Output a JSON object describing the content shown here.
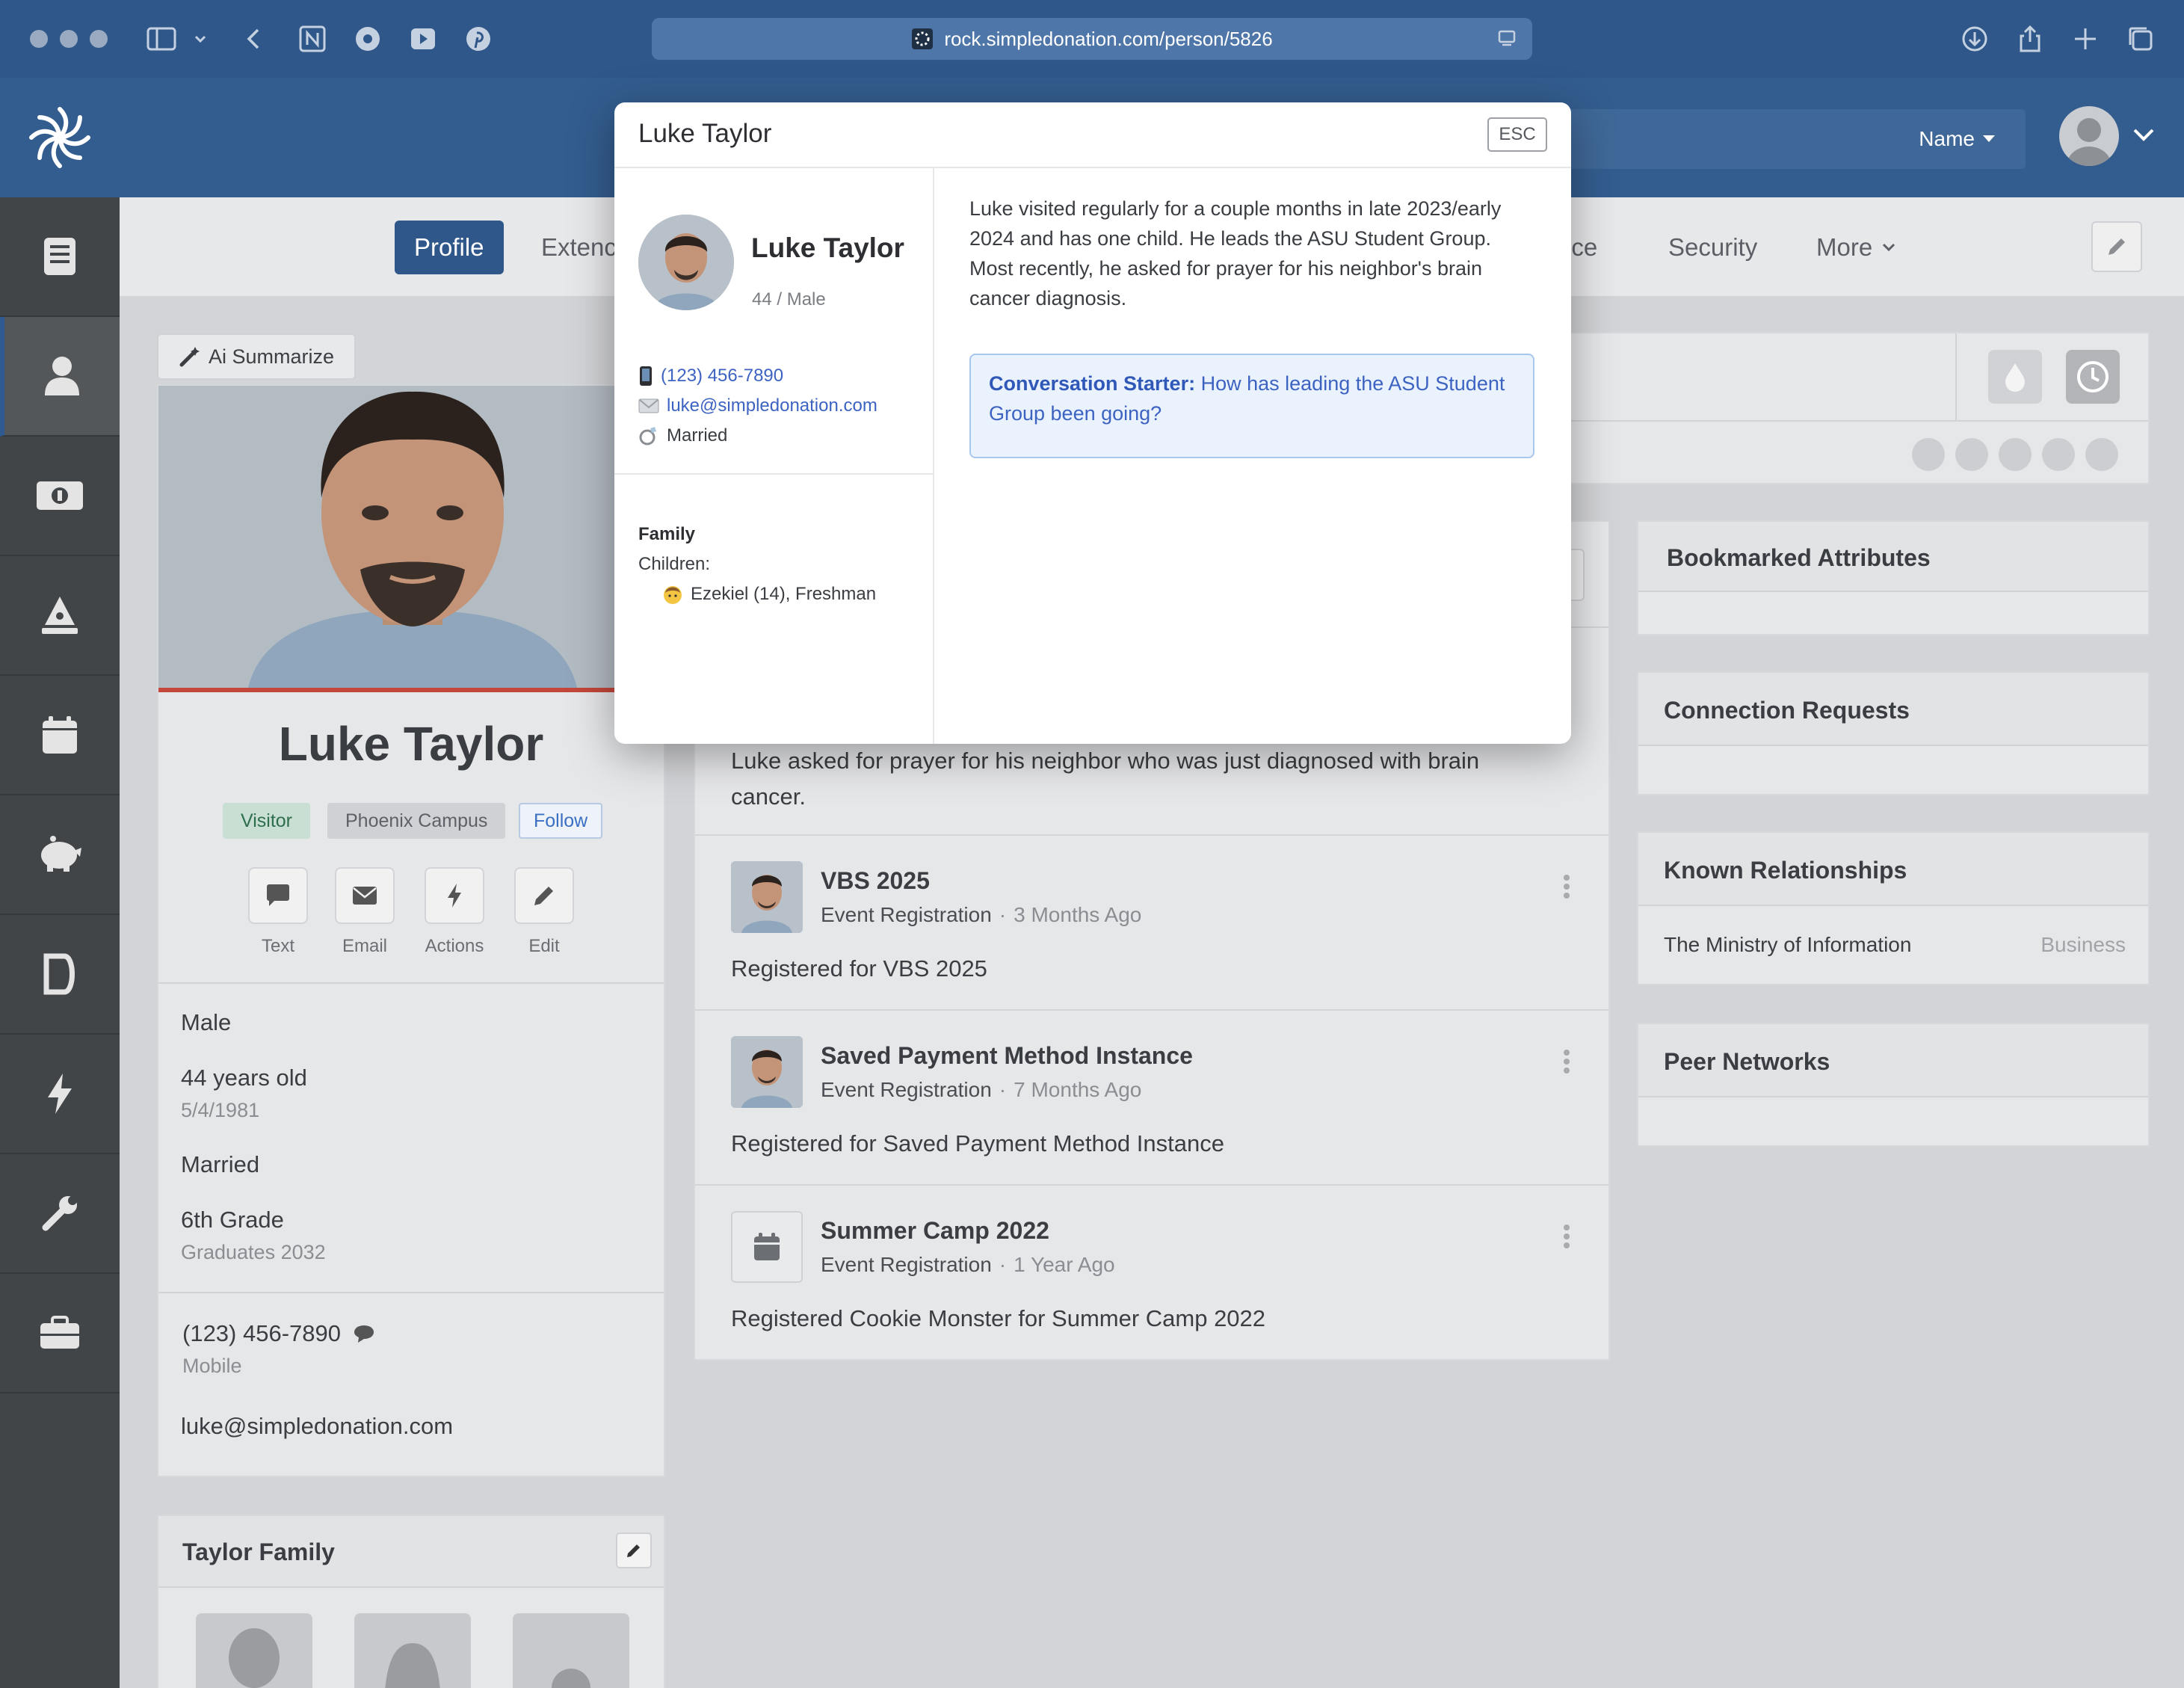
{
  "browser": {
    "url": "rock.simpledonation.com/person/5826"
  },
  "appbar": {
    "search_filter_label": "Name"
  },
  "tabs": {
    "profile": "Profile",
    "extended": "Extenc",
    "attendance_partial": "nce",
    "security": "Security",
    "more": "More"
  },
  "ai_summarize": {
    "label": "Ai Summarize"
  },
  "person": {
    "name": "Luke Taylor",
    "badges": [
      "Visitor",
      "Phoenix Campus",
      "Follow"
    ],
    "actions": [
      "Text",
      "Email",
      "Actions",
      "Edit"
    ],
    "gender": "Male",
    "age": "44 years old",
    "birthdate": "5/4/1981",
    "marital_status": "Married",
    "grade": "6th Grade",
    "graduation": "Graduates 2032",
    "phone": "(123) 456-7890",
    "phone_type": "Mobile",
    "email": "luke@simpledonation.com"
  },
  "family_card": {
    "title": "Taylor Family"
  },
  "feed": {
    "first_item_text": "Luke asked for prayer for his neighbor who was just diagnosed with brain cancer.",
    "items": [
      {
        "title": "VBS 2025",
        "type": "Event Registration",
        "sep": "·",
        "when": "3 Months Ago",
        "body": "Registered for VBS 2025"
      },
      {
        "title": "Saved Payment Method Instance",
        "type": "Event Registration",
        "sep": "·",
        "when": "7 Months Ago",
        "body": "Registered for Saved Payment Method Instance"
      },
      {
        "title": "Summer Camp 2022",
        "type": "Event Registration",
        "sep": "·",
        "when": "1 Year Ago",
        "body": "Registered Cookie Monster  for Summer Camp 2022"
      }
    ]
  },
  "right_cards": {
    "bookmarked": "Bookmarked Attributes",
    "connection_requests": "Connection Requests",
    "known_relationships": "Known Relationships",
    "relationship_name": "The Ministry of Information",
    "relationship_type": "Business",
    "peer_networks": "Peer Networks"
  },
  "modal": {
    "title": "Luke Taylor",
    "esc_label": "ESC",
    "name": "Luke Taylor",
    "age_gender": "44 / Male",
    "phone": "(123) 456-7890",
    "email": "luke@simpledonation.com",
    "marital": "Married",
    "family_heading": "Family",
    "children_label": "Children:",
    "child": "Ezekiel (14), Freshman",
    "summary": "Luke visited regularly for a couple months in late 2023/early 2024 and has one child. He leads the ASU Student Group. Most recently, he asked for prayer for his neighbor's brain cancer diagnosis.",
    "starter_label": "Conversation Starter:",
    "starter_text": "How has leading the ASU Student Group been going?"
  }
}
